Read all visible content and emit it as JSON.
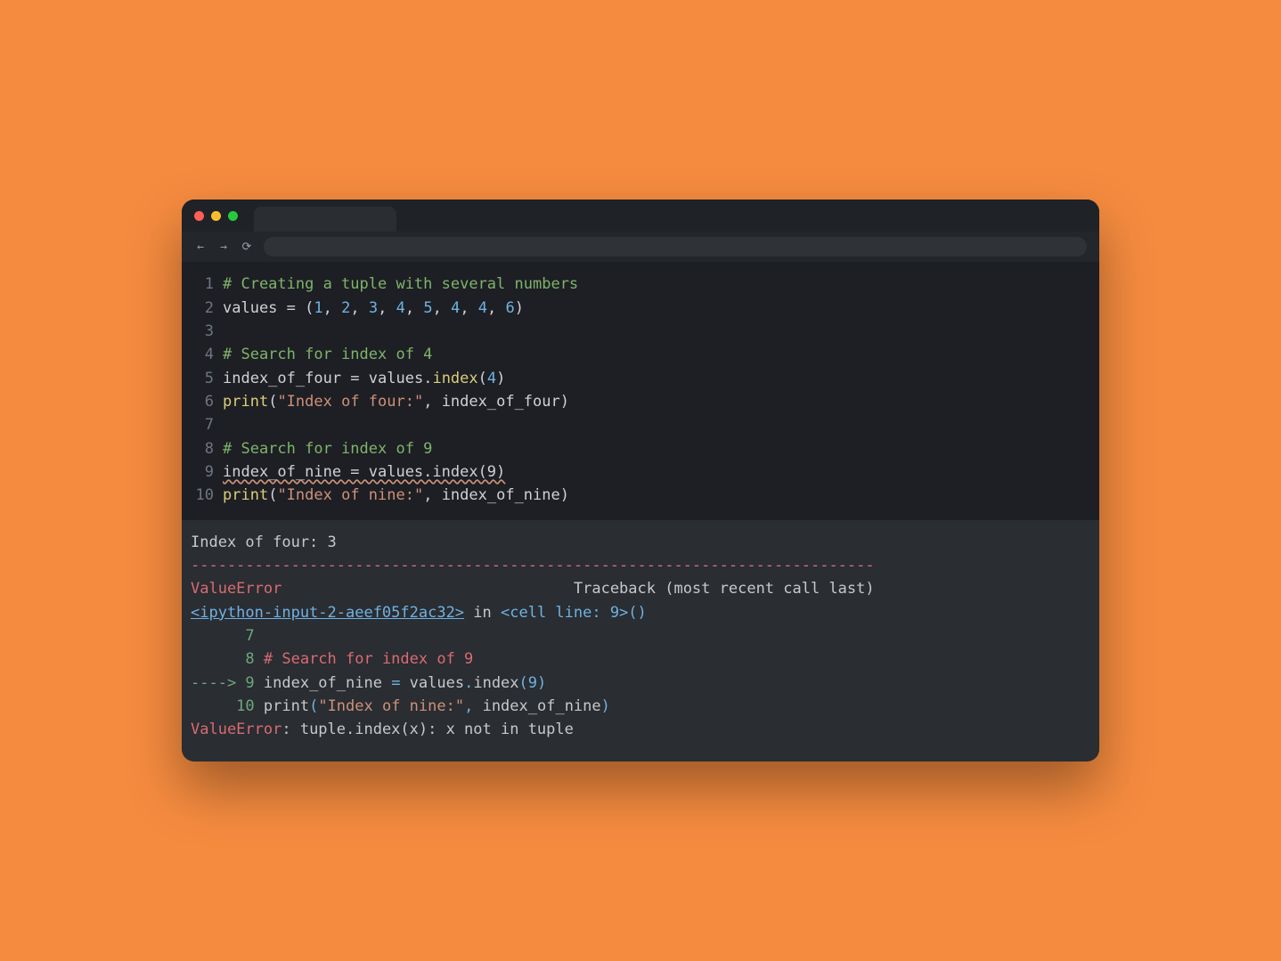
{
  "nav": {
    "back": "←",
    "forward": "→",
    "reload": "⟳"
  },
  "code": {
    "lines": [
      {
        "n": "1",
        "segs": [
          {
            "cls": "tok-comment",
            "t": "# Creating a tuple with several numbers"
          }
        ]
      },
      {
        "n": "2",
        "segs": [
          {
            "cls": "tok-ident",
            "t": "values"
          },
          {
            "cls": "tok-op",
            "t": " = "
          },
          {
            "cls": "tok-punct",
            "t": "("
          },
          {
            "cls": "tok-num",
            "t": "1"
          },
          {
            "cls": "tok-punct",
            "t": ", "
          },
          {
            "cls": "tok-num",
            "t": "2"
          },
          {
            "cls": "tok-punct",
            "t": ", "
          },
          {
            "cls": "tok-num",
            "t": "3"
          },
          {
            "cls": "tok-punct",
            "t": ", "
          },
          {
            "cls": "tok-num",
            "t": "4"
          },
          {
            "cls": "tok-punct",
            "t": ", "
          },
          {
            "cls": "tok-num",
            "t": "5"
          },
          {
            "cls": "tok-punct",
            "t": ", "
          },
          {
            "cls": "tok-num",
            "t": "4"
          },
          {
            "cls": "tok-punct",
            "t": ", "
          },
          {
            "cls": "tok-num",
            "t": "4"
          },
          {
            "cls": "tok-punct",
            "t": ", "
          },
          {
            "cls": "tok-num",
            "t": "6"
          },
          {
            "cls": "tok-punct",
            "t": ")"
          }
        ]
      },
      {
        "n": "3",
        "segs": [
          {
            "cls": "tok-ident",
            "t": ""
          }
        ]
      },
      {
        "n": "4",
        "segs": [
          {
            "cls": "tok-comment",
            "t": "# Search for index of 4"
          }
        ]
      },
      {
        "n": "5",
        "segs": [
          {
            "cls": "tok-ident",
            "t": "index_of_four"
          },
          {
            "cls": "tok-op",
            "t": " = "
          },
          {
            "cls": "tok-ident",
            "t": "values"
          },
          {
            "cls": "tok-punct",
            "t": "."
          },
          {
            "cls": "tok-func",
            "t": "index"
          },
          {
            "cls": "tok-punct",
            "t": "("
          },
          {
            "cls": "tok-num",
            "t": "4"
          },
          {
            "cls": "tok-punct",
            "t": ")"
          }
        ]
      },
      {
        "n": "6",
        "segs": [
          {
            "cls": "tok-func",
            "t": "print"
          },
          {
            "cls": "tok-punct",
            "t": "("
          },
          {
            "cls": "tok-str",
            "t": "\"Index of four:\""
          },
          {
            "cls": "tok-punct",
            "t": ", "
          },
          {
            "cls": "tok-ident",
            "t": "index_of_four"
          },
          {
            "cls": "tok-punct",
            "t": ")"
          }
        ]
      },
      {
        "n": "7",
        "segs": [
          {
            "cls": "tok-ident",
            "t": ""
          }
        ]
      },
      {
        "n": "8",
        "segs": [
          {
            "cls": "tok-comment",
            "t": "# Search for index of 9"
          }
        ]
      },
      {
        "n": "9",
        "segs": [
          {
            "cls": "tok-ident squiggle",
            "t": "index_of_nine = values.index(9)"
          }
        ]
      },
      {
        "n": "10",
        "segs": [
          {
            "cls": "tok-func",
            "t": "print"
          },
          {
            "cls": "tok-punct",
            "t": "("
          },
          {
            "cls": "tok-str",
            "t": "\"Index of nine:\""
          },
          {
            "cls": "tok-punct",
            "t": ", "
          },
          {
            "cls": "tok-ident",
            "t": "index_of_nine"
          },
          {
            "cls": "tok-punct",
            "t": ")"
          }
        ]
      }
    ]
  },
  "output": {
    "lines": [
      [
        {
          "cls": "o-plain",
          "t": "Index of four: 3"
        }
      ],
      [
        {
          "cls": "o-dashes",
          "t": "---------------------------------------------------------------------------"
        }
      ],
      [
        {
          "cls": "o-err",
          "t": "ValueError"
        },
        {
          "cls": "o-trace",
          "t": "                                Traceback (most recent call last)"
        }
      ],
      [
        {
          "cls": "o-link",
          "t": "<ipython-input-2-aeef05f2ac32>"
        },
        {
          "cls": "o-trace",
          "t": " in "
        },
        {
          "cls": "o-in",
          "t": "<cell line: 9>"
        },
        {
          "cls": "o-in",
          "t": "()"
        }
      ],
      [
        {
          "cls": "o-lineno",
          "t": "      7 "
        }
      ],
      [
        {
          "cls": "o-lineno",
          "t": "      8 "
        },
        {
          "cls": "o-comment",
          "t": "# Search for index of 9"
        }
      ],
      [
        {
          "cls": "o-arrow",
          "t": "----> 9 "
        },
        {
          "cls": "o-code",
          "t": "index_of_nine "
        },
        {
          "cls": "o-code-bl",
          "t": "="
        },
        {
          "cls": "o-code",
          "t": " values"
        },
        {
          "cls": "o-code-bl",
          "t": "."
        },
        {
          "cls": "o-code",
          "t": "index"
        },
        {
          "cls": "o-code-bl",
          "t": "(9)"
        }
      ],
      [
        {
          "cls": "o-lineno",
          "t": "     10 "
        },
        {
          "cls": "o-code",
          "t": "print"
        },
        {
          "cls": "o-code-bl",
          "t": "("
        },
        {
          "cls": "o-str",
          "t": "\"Index of nine:\""
        },
        {
          "cls": "o-code-bl",
          "t": ","
        },
        {
          "cls": "o-code",
          "t": " index_of_nine"
        },
        {
          "cls": "o-code-bl",
          "t": ")"
        }
      ],
      [
        {
          "cls": "o-plain",
          "t": ""
        }
      ],
      [
        {
          "cls": "o-err",
          "t": "ValueError"
        },
        {
          "cls": "o-plain",
          "t": ": tuple.index(x): x not in tuple"
        }
      ]
    ]
  }
}
